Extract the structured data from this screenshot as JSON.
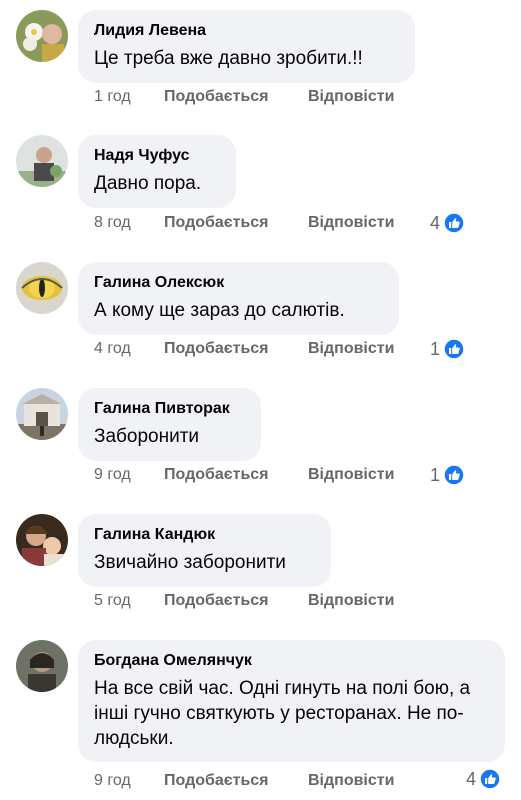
{
  "like_icon": "like-reaction-icon",
  "accent": "#1877f2",
  "comments": [
    {
      "author": "Лидия Левена",
      "text": "Це треба вже давно зробити.!!",
      "time": "1 год",
      "like": "Подобається",
      "reply": "Відповісти",
      "reactions": ""
    },
    {
      "author": "Надя Чуфус",
      "text": "Давно пора.",
      "time": "8 год",
      "like": "Подобається",
      "reply": "Відповісти",
      "reactions": "4"
    },
    {
      "author": "Галина Олексюк",
      "text": "А кому ще зараз до салютів.",
      "time": "4 год",
      "like": "Подобається",
      "reply": "Відповісти",
      "reactions": "1"
    },
    {
      "author": "Галина Пивторак",
      "text": "Заборонити",
      "time": "9 год",
      "like": "Подобається",
      "reply": "Відповісти",
      "reactions": "1"
    },
    {
      "author": "Галина Кандюк",
      "text": "Звичайно заборонити",
      "time": "5 год",
      "like": "Подобається",
      "reply": "Відповісти",
      "reactions": ""
    },
    {
      "author": "Богдана Омелянчук",
      "text": "На все свій час. Одні гинуть на полі бою, а інші гучно святкують у ресторанах. Не по-людськи.",
      "time": "9 год",
      "like": "Подобається",
      "reply": "Відповісти",
      "reactions": "4"
    }
  ]
}
